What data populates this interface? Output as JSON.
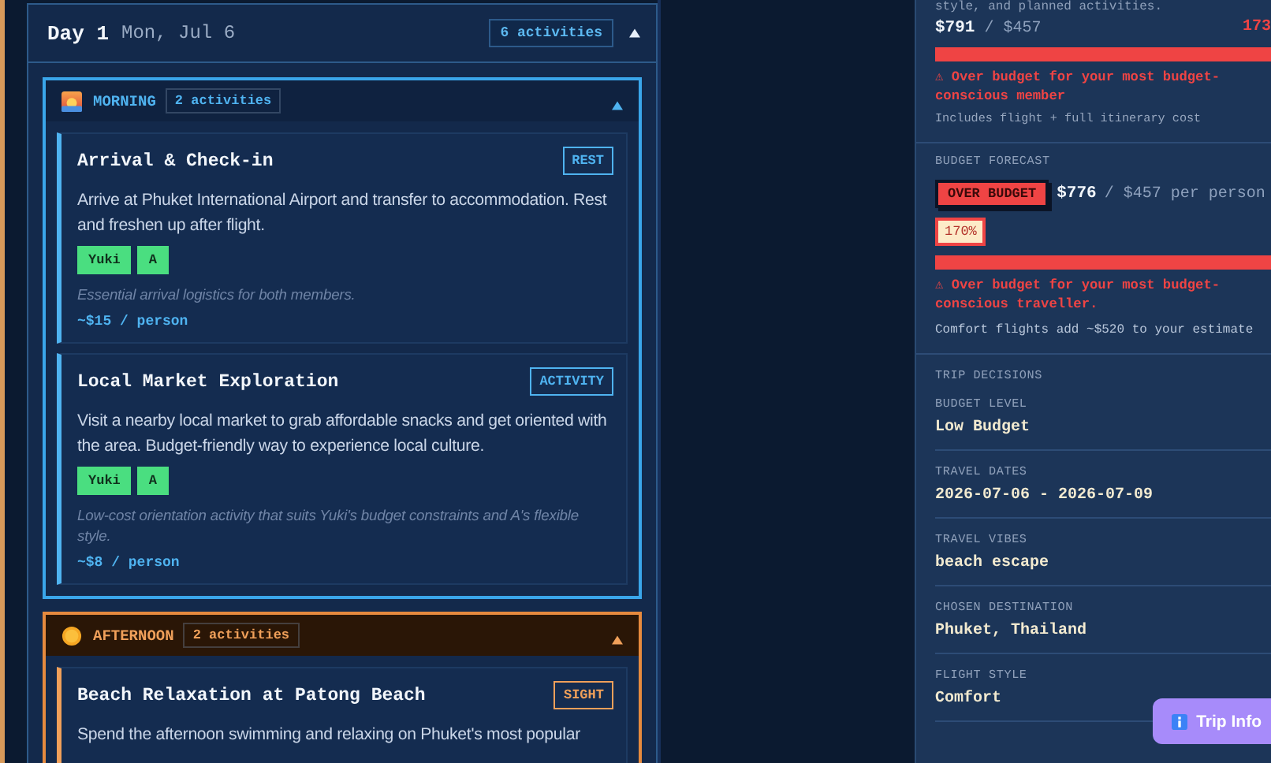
{
  "day": {
    "title": "Day 1",
    "date": "Mon, Jul 6",
    "count": "6 activities",
    "expanded": true,
    "periods": [
      {
        "kind": "morning",
        "label": "MORNING",
        "count": "2 activities",
        "expanded": true,
        "activities": [
          {
            "title": "Arrival & Check-in",
            "type": "REST",
            "description": "Arrive at Phuket International Airport and transfer to accommodation. Rest and freshen up after flight.",
            "members": [
              "Yuki",
              "A"
            ],
            "note": "Essential arrival logistics for both members.",
            "cost": "~$15 / person"
          },
          {
            "title": "Local Market Exploration",
            "type": "ACTIVITY",
            "description": "Visit a nearby local market to grab affordable snacks and get oriented with the area. Budget-friendly way to experience local culture.",
            "members": [
              "Yuki",
              "A"
            ],
            "note": "Low-cost orientation activity that suits Yuki's budget constraints and A's flexible style.",
            "cost": "~$8 / person"
          }
        ]
      },
      {
        "kind": "afternoon",
        "label": "AFTERNOON",
        "count": "2 activities",
        "expanded": true,
        "activities": [
          {
            "title": "Beach Relaxation at Patong Beach",
            "type": "SIGHT",
            "description": "Spend the afternoon swimming and relaxing on Phuket's most popular"
          }
        ]
      }
    ]
  },
  "sidebar": {
    "intro": "style, and planned activities.",
    "cost_summary": {
      "spent": "$791",
      "budget": "/ $457",
      "percent": "173",
      "level": 1,
      "warning": "⚠ Over budget for your most budget-conscious member",
      "note": "Includes flight + full itinerary cost"
    },
    "forecast": {
      "heading": "BUDGET FORECAST",
      "status": "OVER BUDGET",
      "spent": "$776",
      "budget": "/ $457 per person",
      "percent": "170%",
      "level": 1,
      "warning": "⚠ Over budget for your most budget-conscious traveller.",
      "note": "Comfort flights add ~$520 to your estimate"
    },
    "decisions": {
      "heading": "TRIP DECISIONS",
      "items": [
        {
          "label": "BUDGET LEVEL",
          "value": "Low Budget"
        },
        {
          "label": "TRAVEL DATES",
          "value": "2026-07-06 - 2026-07-09"
        },
        {
          "label": "TRAVEL VIBES",
          "value": "beach escape"
        },
        {
          "label": "CHOSEN DESTINATION",
          "value": "Phuket, Thailand"
        },
        {
          "label": "FLIGHT STYLE",
          "value": "Comfort"
        }
      ]
    }
  },
  "trip_info_button": {
    "label": "Trip Info"
  }
}
